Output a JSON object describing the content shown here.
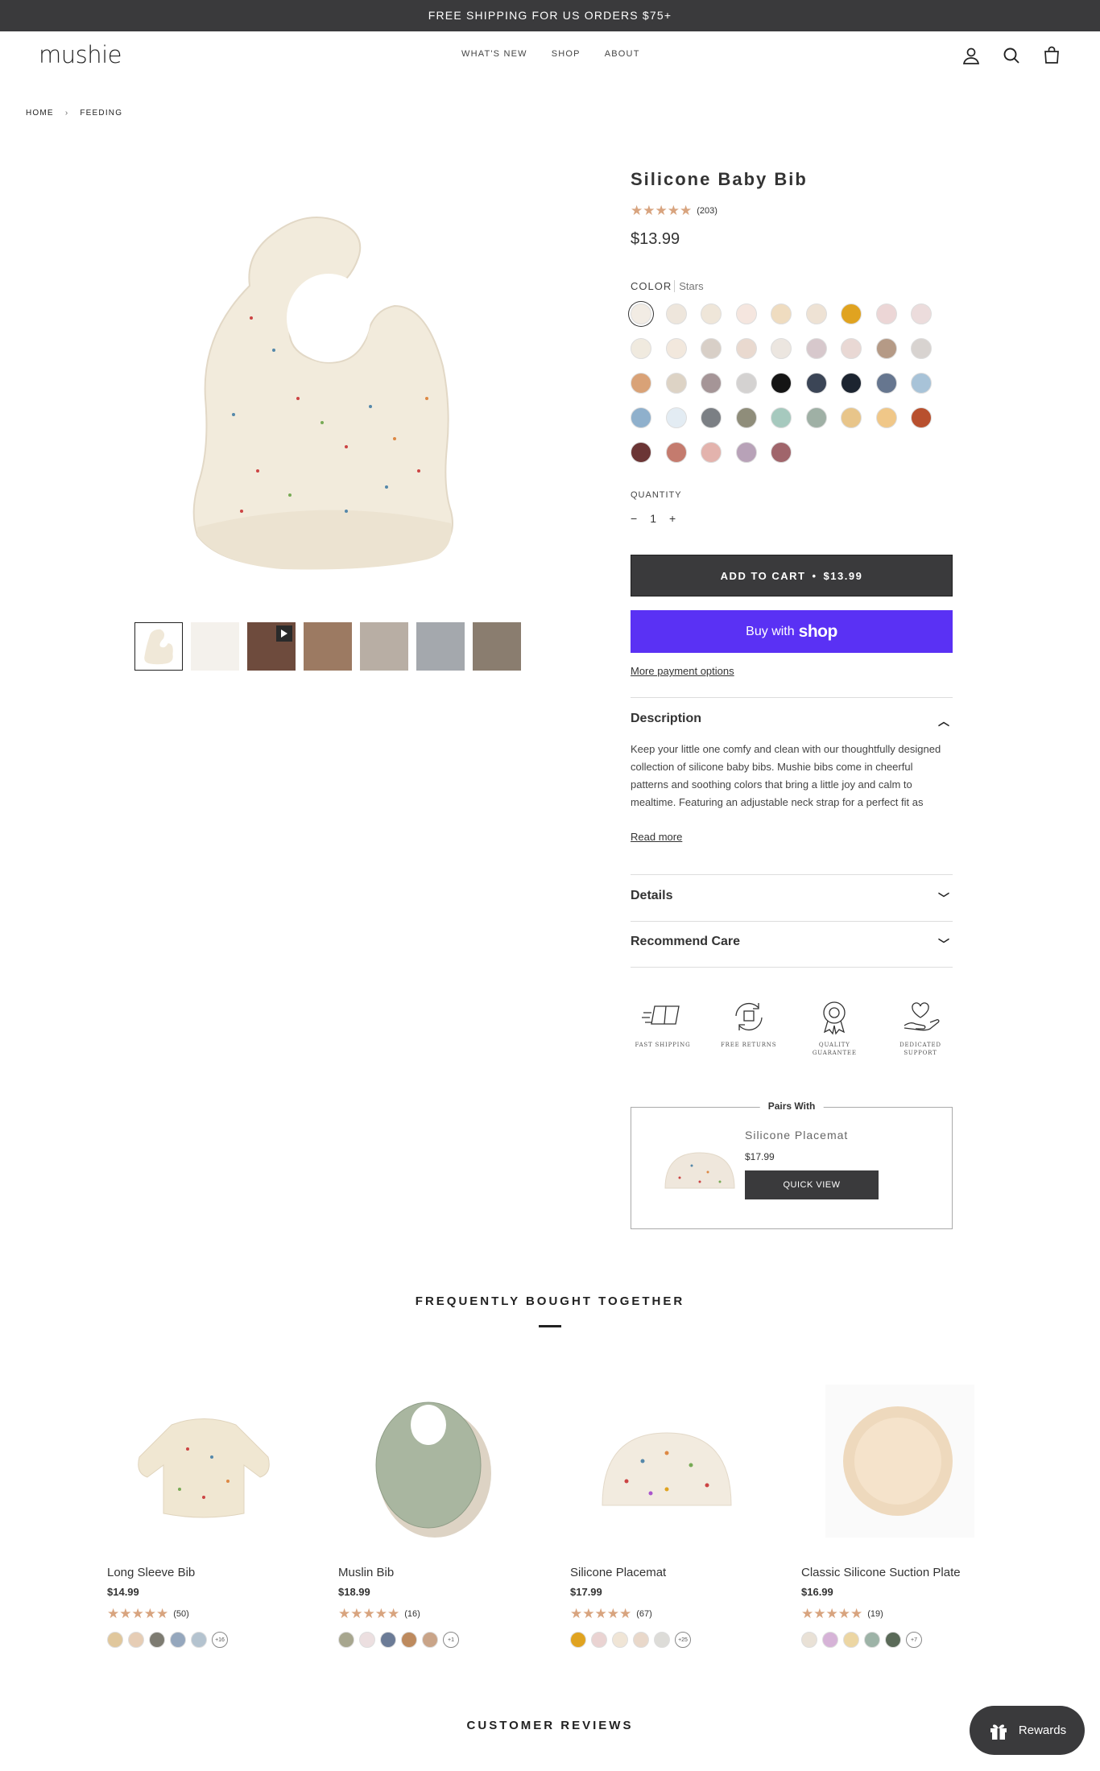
{
  "announcement": "FREE SHIPPING FOR US ORDERS $75+",
  "header": {
    "logo": "mushie",
    "nav": [
      "WHAT'S NEW",
      "SHOP",
      "ABOUT"
    ]
  },
  "breadcrumb": [
    "HOME",
    "FEEDING"
  ],
  "product": {
    "title": "Silicone Baby Bib",
    "stars": "★★★★★",
    "review_count": "(203)",
    "price": "$13.99",
    "color_label": "COLOR",
    "color_value": "Stars",
    "swatch_colors": [
      "#f2ece4",
      "#eee6dc",
      "#efe6d9",
      "#f5e6df",
      "#efdcc0",
      "#eee2d4",
      "#e0a320",
      "#ecd6d6",
      "#ecdcdc",
      "#f0eadf",
      "#f2e8dd",
      "#d8cfc7",
      "#e9d9cf",
      "#ece6e0",
      "#d7c8cc",
      "#e9d8d4",
      "#b59a86",
      "#d8d3d0",
      "#d9a277",
      "#ddd3c5",
      "#a59597",
      "#d4d2d1",
      "#151515",
      "#3b4556",
      "#1c2430",
      "#66768f",
      "#a8c3d8",
      "#8fb0cc",
      "#e3ecf3",
      "#7b7f84",
      "#8f8d7a",
      "#a6c9be",
      "#9fb0a5",
      "#e8c58a",
      "#f0c788",
      "#b8502e",
      "#6b3535",
      "#c47b6e",
      "#e3b3ad",
      "#b8a2b8",
      "#a0656b"
    ],
    "quantity_label": "QUANTITY",
    "quantity_minus": "−",
    "quantity_value": "1",
    "quantity_plus": "+",
    "add_to_cart": "ADD TO CART",
    "add_to_cart_sep": "•",
    "add_to_cart_price": "$13.99",
    "buy_with": "Buy with",
    "shop_word": "shop",
    "more_payment": "More payment options",
    "description_title": "Description",
    "description_text": "Keep your little one comfy and clean with our thoughtfully designed collection of silicone baby bibs. Mushie bibs come in cheerful patterns and soothing colors that bring a little joy and calm to mealtime. Featuring an adjustable neck strap for a perfect fit as",
    "read_more": "Read more",
    "details_title": "Details",
    "care_title": "Recommend Care",
    "features": [
      {
        "icon": "box-icon",
        "label": "FAST SHIPPING"
      },
      {
        "icon": "return-icon",
        "label": "FREE RETURNS"
      },
      {
        "icon": "badge-icon",
        "label": "QUALITY GUARANTEE"
      },
      {
        "icon": "heart-hand-icon",
        "label": "DEDICATED SUPPORT"
      }
    ],
    "pairs_with": {
      "label": "Pairs With",
      "name": "Silicone Placemat",
      "price": "$17.99",
      "button": "QUICK VIEW"
    }
  },
  "fbt": {
    "title": "FREQUENTLY BOUGHT TOGETHER",
    "products": [
      {
        "name": "Long Sleeve Bib",
        "price": "$14.99",
        "stars": "★★★★★",
        "reviews": "(50)",
        "more": "+16",
        "swatches": [
          "#e0c79c",
          "#e6cdb5",
          "#7d7b71",
          "#95a7bd",
          "#b4c3cf"
        ]
      },
      {
        "name": "Muslin Bib",
        "price": "$18.99",
        "stars": "★★★★★",
        "reviews": "(16)",
        "more": "+1",
        "swatches": [
          "#a7a68e",
          "#ecdfe0",
          "#6b7b96",
          "#bd8a5e",
          "#c9a488"
        ]
      },
      {
        "name": "Silicone Placemat",
        "price": "$17.99",
        "stars": "★★★★★",
        "reviews": "(67)",
        "more": "+25",
        "swatches": [
          "#e0a320",
          "#ead3d2",
          "#f0e5d6",
          "#e9d8ca",
          "#dddcd8"
        ]
      },
      {
        "name": "Classic Silicone Suction Plate",
        "price": "$16.99",
        "stars": "★★★★★",
        "reviews": "(19)",
        "more": "+7",
        "swatches": [
          "#e9e1d6",
          "#d6b3d7",
          "#ecd6a3",
          "#9db3a7",
          "#5a6a58"
        ]
      }
    ]
  },
  "customer_reviews": "CUSTOMER REVIEWS",
  "rewards": "Rewards"
}
